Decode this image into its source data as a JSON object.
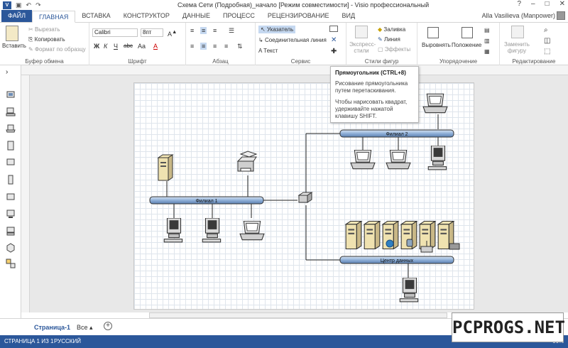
{
  "titlebar": {
    "title": "Схема Сети (Подробная)_начало  [Режим совместимости] - Visio профессиональный",
    "help": "?",
    "minimize": "–",
    "maximize": "□",
    "close": "✕"
  },
  "tabs": [
    "ФАЙЛ",
    "ГЛАВНАЯ",
    "ВСТАВКА",
    "КОНСТРУКТОР",
    "ДАННЫЕ",
    "ПРОЦЕСС",
    "РЕЦЕНЗИРОВАНИЕ",
    "ВИД"
  ],
  "user": "Alla Vasilieva (Manpower)",
  "ribbon": {
    "clipboard": {
      "label": "Буфер обмена",
      "paste": "Вставить",
      "cut": "Вырезать",
      "copy": "Копировать",
      "format": "Формат по образцу"
    },
    "font": {
      "label": "Шрифт",
      "name": "Calibri",
      "size": "8пт",
      "bold": "Ж",
      "italic": "К",
      "underline": "Ч",
      "strike": "abc",
      "case": "Aa",
      "color": "A"
    },
    "paragraph": {
      "label": "Абзац"
    },
    "tools": {
      "label": "Сервис",
      "pointer": "Указатель",
      "connector": "Соединительная линия",
      "text": "Текст",
      "close": "✕"
    },
    "styles": {
      "label": "Стили фигур",
      "express": "Экспресс-стили",
      "fill": "Заливка",
      "line": "Линия",
      "effects": "Эффекты"
    },
    "arrange": {
      "label": "Упорядочение",
      "align": "Выровнять",
      "position": "Положение"
    },
    "editing": {
      "label": "Редактирование",
      "change": "Заменить фигуру"
    }
  },
  "tooltip": {
    "title": "Прямоугольник (CTRL+8)",
    "body1": "Рисование прямоугольника путем перетаскивания.",
    "body2": "Чтобы нарисовать квадрат, удерживайте нажатой клавишу SHIFT."
  },
  "diagram": {
    "bus1": "Филиал 1",
    "bus2": "Филиал 2",
    "bus3": "Центр данных"
  },
  "pagebar": {
    "page": "Страница-1",
    "all": "Все",
    "add": "+"
  },
  "status": {
    "page": "СТРАНИЦА 1 ИЗ 1",
    "lang": "РУССКИЙ",
    "zoom": "66%"
  },
  "watermark": "PCPROGS.NET",
  "colors": {
    "accent": "#2b579a",
    "bus": "#8fb0d8"
  }
}
